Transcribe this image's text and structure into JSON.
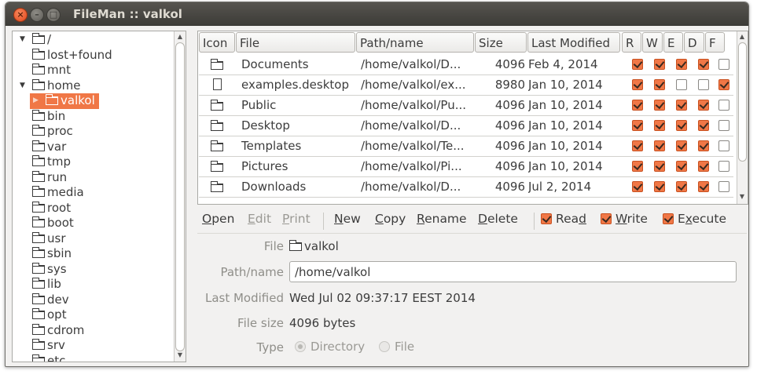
{
  "window": {
    "title": "FileMan :: valkol"
  },
  "tree": {
    "items": [
      {
        "label": "/",
        "expanded": true
      },
      {
        "label": "lost+found"
      },
      {
        "label": "mnt"
      },
      {
        "label": "home",
        "expanded": true
      },
      {
        "label": "valkol",
        "selected": true
      },
      {
        "label": "bin"
      },
      {
        "label": "proc"
      },
      {
        "label": "var"
      },
      {
        "label": "tmp"
      },
      {
        "label": "run"
      },
      {
        "label": "media"
      },
      {
        "label": "root"
      },
      {
        "label": "boot"
      },
      {
        "label": "usr"
      },
      {
        "label": "sbin"
      },
      {
        "label": "sys"
      },
      {
        "label": "lib"
      },
      {
        "label": "dev"
      },
      {
        "label": "opt"
      },
      {
        "label": "cdrom"
      },
      {
        "label": "srv"
      },
      {
        "label": "etc"
      }
    ]
  },
  "table": {
    "columns": [
      "Icon",
      "File",
      "Path/name",
      "Size",
      "Last Modified",
      "R",
      "W",
      "E",
      "D",
      "F"
    ],
    "rows": [
      {
        "icon": "folder-icon",
        "file": "Documents",
        "path": "/home/valkol/D...",
        "size": "4096",
        "modified": "Feb 4, 2014",
        "r": true,
        "w": true,
        "e": true,
        "d": true,
        "f": false
      },
      {
        "icon": "document-icon",
        "file": "examples.desktop",
        "path": "/home/valkol/ex...",
        "size": "8980",
        "modified": "Jan 10, 2014",
        "r": true,
        "w": true,
        "e": false,
        "d": false,
        "f": true
      },
      {
        "icon": "folder-icon",
        "file": "Public",
        "path": "/home/valkol/Pu...",
        "size": "4096",
        "modified": "Jan 10, 2014",
        "r": true,
        "w": true,
        "e": true,
        "d": true,
        "f": false
      },
      {
        "icon": "folder-icon",
        "file": "Desktop",
        "path": "/home/valkol/D...",
        "size": "4096",
        "modified": "Jan 10, 2014",
        "r": true,
        "w": true,
        "e": true,
        "d": true,
        "f": false
      },
      {
        "icon": "folder-icon",
        "file": "Templates",
        "path": "/home/valkol/Te...",
        "size": "4096",
        "modified": "Jan 10, 2014",
        "r": true,
        "w": true,
        "e": true,
        "d": true,
        "f": false
      },
      {
        "icon": "folder-icon",
        "file": "Pictures",
        "path": "/home/valkol/Pi...",
        "size": "4096",
        "modified": "Jan 10, 2014",
        "r": true,
        "w": true,
        "e": true,
        "d": true,
        "f": false
      },
      {
        "icon": "folder-icon",
        "file": "Downloads",
        "path": "/home/valkol/D...",
        "size": "4096",
        "modified": "Jul 2, 2014",
        "r": true,
        "w": true,
        "e": true,
        "d": true,
        "f": false
      }
    ]
  },
  "toolbar": {
    "open": "Open",
    "edit": "Edit",
    "print": "Print",
    "new": "New",
    "copy": "Copy",
    "rename": "Rename",
    "delete": "Delete",
    "read": "Read",
    "write": "Write",
    "execute": "Execute",
    "read_checked": true,
    "write_checked": true,
    "execute_checked": true
  },
  "details": {
    "file_label": "File",
    "file_value": "valkol",
    "path_label": "Path/name",
    "path_value": "/home/valkol",
    "modified_label": "Last Modified",
    "modified_value": "Wed Jul 02 09:37:17 EEST 2014",
    "size_label": "File size",
    "size_value": "4096 bytes",
    "type_label": "Type",
    "type_directory": "Directory",
    "type_file": "File",
    "type_selected": "Directory"
  },
  "colors": {
    "accent": "#f07746",
    "titlebar": "#3c3b37",
    "window_bg": "#f2f1f0"
  }
}
